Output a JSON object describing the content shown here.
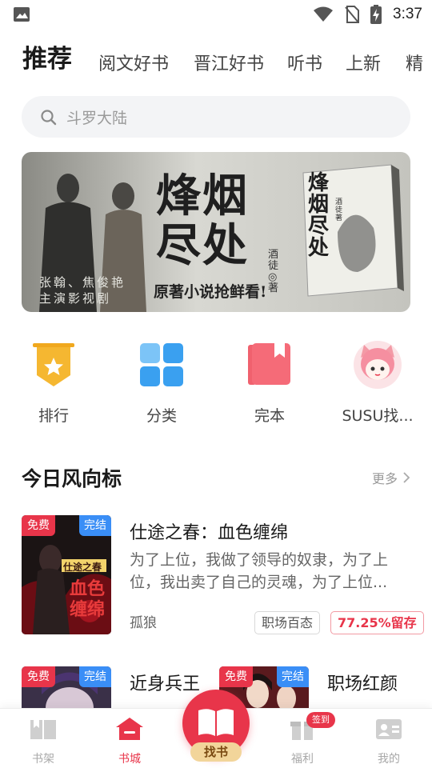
{
  "status_bar": {
    "time": "3:37",
    "icons": [
      "image-icon",
      "wifi-icon",
      "no-sim-icon",
      "battery-charging-icon"
    ]
  },
  "tabs": {
    "active": "推荐",
    "items": [
      "阅文好书",
      "晋江好书",
      "听书",
      "上新",
      "精"
    ]
  },
  "search": {
    "placeholder": "斗罗大陆"
  },
  "banner": {
    "title": "烽烟尽处",
    "author": "酒徒◎著",
    "slogan": "原著小说抢鲜看!",
    "cast": "张翰、焦俊艳",
    "cast_role": "主演影视剧",
    "cover_title": "烽烟尽处",
    "cover_author": "酒徒著"
  },
  "categories": [
    {
      "label": "排行",
      "icon": "ranking-badge-icon"
    },
    {
      "label": "分类",
      "icon": "grid-category-icon"
    },
    {
      "label": "完本",
      "icon": "finished-book-icon"
    },
    {
      "label": "SUSU找...",
      "icon": "susu-avatar-icon"
    }
  ],
  "section": {
    "title": "今日风向标",
    "more": "更多"
  },
  "books": [
    {
      "badge_free": "免费",
      "badge_done": "完结",
      "title": "仕途之春：血色缠绵",
      "desc_line1": "为了上位，我做了领导的奴隶，为了上",
      "desc_line2": "位，我出卖了自己的灵魂，为了上位...",
      "author": "孤狼",
      "tag": "职场百态",
      "retention": "77.25%留存",
      "cover_text1": "仕途之春",
      "cover_text2": "血色",
      "cover_text3": "缠绵"
    },
    {
      "badge_free": "免费",
      "badge_done": "完结",
      "title": "近身兵王"
    },
    {
      "badge_free": "免费",
      "badge_done": "完结",
      "title": "职场红颜"
    }
  ],
  "bottom_nav": {
    "items": [
      {
        "label": "书架",
        "icon": "bookshelf-icon"
      },
      {
        "label": "书城",
        "icon": "bookstore-icon"
      },
      {
        "label": "福利",
        "icon": "gift-icon"
      },
      {
        "label": "我的",
        "icon": "profile-card-icon"
      }
    ],
    "center_label": "找书",
    "sign_badge": "签到"
  },
  "colors": {
    "accent": "#e8354a",
    "done_badge": "#3a8ef6",
    "category_blue": "#3aa0f0",
    "category_gold": "#f5b731"
  }
}
